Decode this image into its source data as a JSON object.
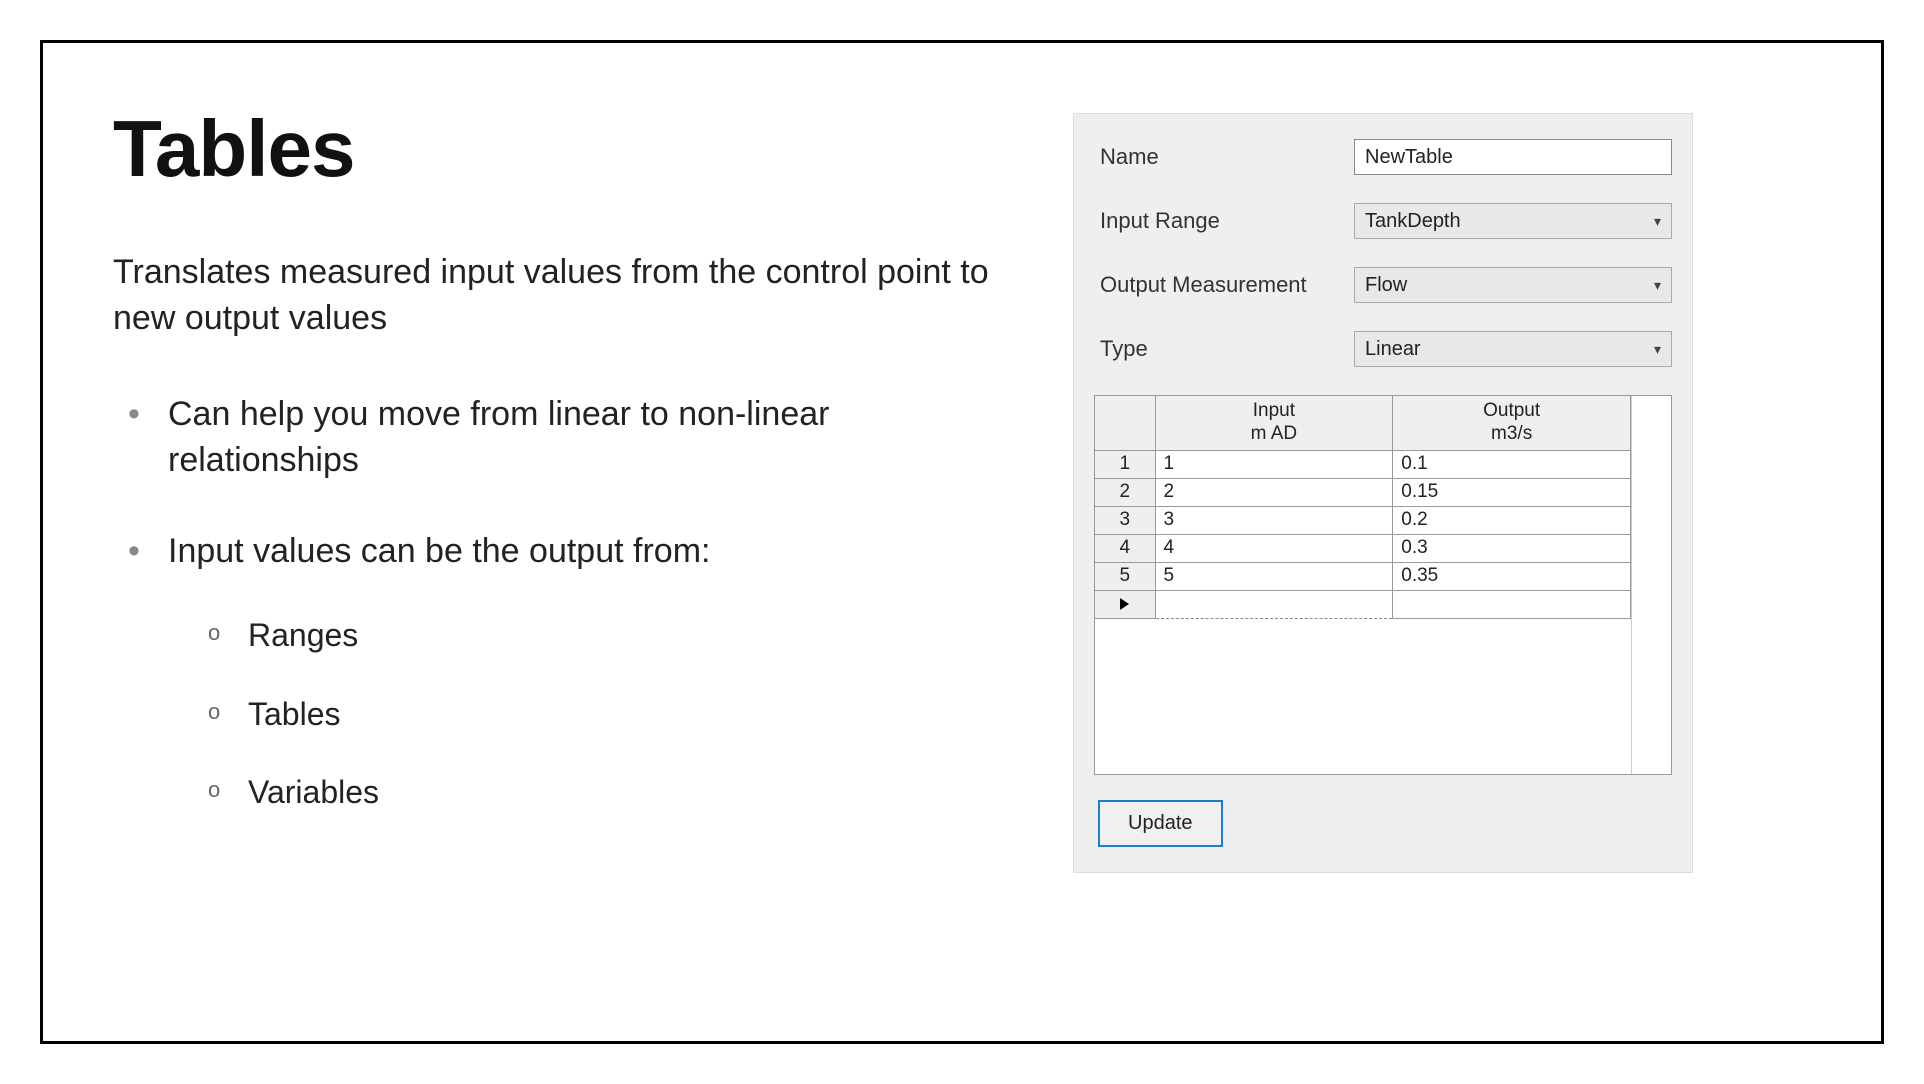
{
  "slide": {
    "title": "Tables",
    "subtitle": "Translates measured input values from the control point to new output values",
    "bullets": [
      "Can help you move from linear to non-linear relationships",
      "Input values can be the output from:"
    ],
    "sub_bullets": [
      "Ranges",
      "Tables",
      "Variables"
    ]
  },
  "dialog": {
    "name_label": "Name",
    "name_value": "NewTable",
    "input_range_label": "Input Range",
    "input_range_value": "TankDepth",
    "output_measurement_label": "Output Measurement",
    "output_measurement_value": "Flow",
    "type_label": "Type",
    "type_value": "Linear",
    "headers": {
      "input_line1": "Input",
      "input_line2": "m AD",
      "output_line1": "Output",
      "output_line2": "m3/s"
    },
    "rows": [
      {
        "n": "1",
        "input": "1",
        "output": "0.1"
      },
      {
        "n": "2",
        "input": "2",
        "output": "0.15"
      },
      {
        "n": "3",
        "input": "3",
        "output": "0.2"
      },
      {
        "n": "4",
        "input": "4",
        "output": "0.3"
      },
      {
        "n": "5",
        "input": "5",
        "output": "0.35"
      }
    ],
    "update_button": "Update"
  }
}
